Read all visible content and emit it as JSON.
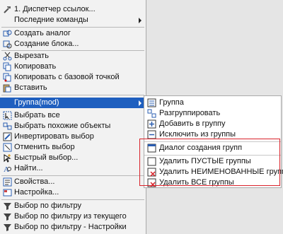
{
  "main_menu": {
    "items": [
      {
        "label": "1. Диспетчер ссылок...",
        "icon": "hammer-icon"
      },
      {
        "label": "Последние команды",
        "icon": "none"
      },
      {
        "label": "Создать аналог",
        "icon": "create-similar-icon"
      },
      {
        "label": "Создание блока...",
        "icon": "create-block-icon"
      },
      {
        "label": "Вырезать",
        "icon": "scissors-icon"
      },
      {
        "label": "Копировать",
        "icon": "copy-icon"
      },
      {
        "label": "Копировать с базовой точкой",
        "icon": "copy-basepoint-icon"
      },
      {
        "label": "Вставить",
        "icon": "paste-icon"
      },
      {
        "label": "Группа(mod)",
        "icon": "none"
      },
      {
        "label": "Выбрать все",
        "icon": "select-all-icon"
      },
      {
        "label": "Выбрать похожие объекты",
        "icon": "select-similar-icon"
      },
      {
        "label": "Инвертировать выбор",
        "icon": "invert-selection-icon"
      },
      {
        "label": "Отменить выбор",
        "icon": "deselect-icon"
      },
      {
        "label": "Быстрый выбор...",
        "icon": "quick-select-icon"
      },
      {
        "label": "Найти...",
        "icon": "find-icon"
      },
      {
        "label": "Свойства...",
        "icon": "properties-icon"
      },
      {
        "label": "Настройка...",
        "icon": "settings-icon"
      },
      {
        "label": "Выбор по фильтру",
        "icon": "filter-icon"
      },
      {
        "label": "Выбор по фильтру из текущего",
        "icon": "filter-icon"
      },
      {
        "label": "Выбор по фильтру - Настройки",
        "icon": "filter-icon"
      }
    ]
  },
  "group_submenu": {
    "items": [
      {
        "label": "Группа",
        "icon": "group-icon"
      },
      {
        "label": "Разгруппировать",
        "icon": "ungroup-icon"
      },
      {
        "label": "Добавить в группу",
        "icon": "add-to-group-icon"
      },
      {
        "label": "Исключить из группы",
        "icon": "remove-from-group-icon"
      },
      {
        "label": "Диалог создания групп",
        "icon": "group-dialog-icon"
      },
      {
        "label": "Удалить ПУСТЫЕ группы",
        "icon": "delete-empty-groups-icon"
      },
      {
        "label": "Удалить НЕИМЕНОВАННЫЕ группы",
        "icon": "delete-unnamed-groups-icon"
      },
      {
        "label": "Удалить ВСЕ группы",
        "icon": "delete-all-groups-icon"
      }
    ]
  },
  "colors": {
    "highlight": "#1f5fbf",
    "annotation_box": "#d9222a"
  }
}
